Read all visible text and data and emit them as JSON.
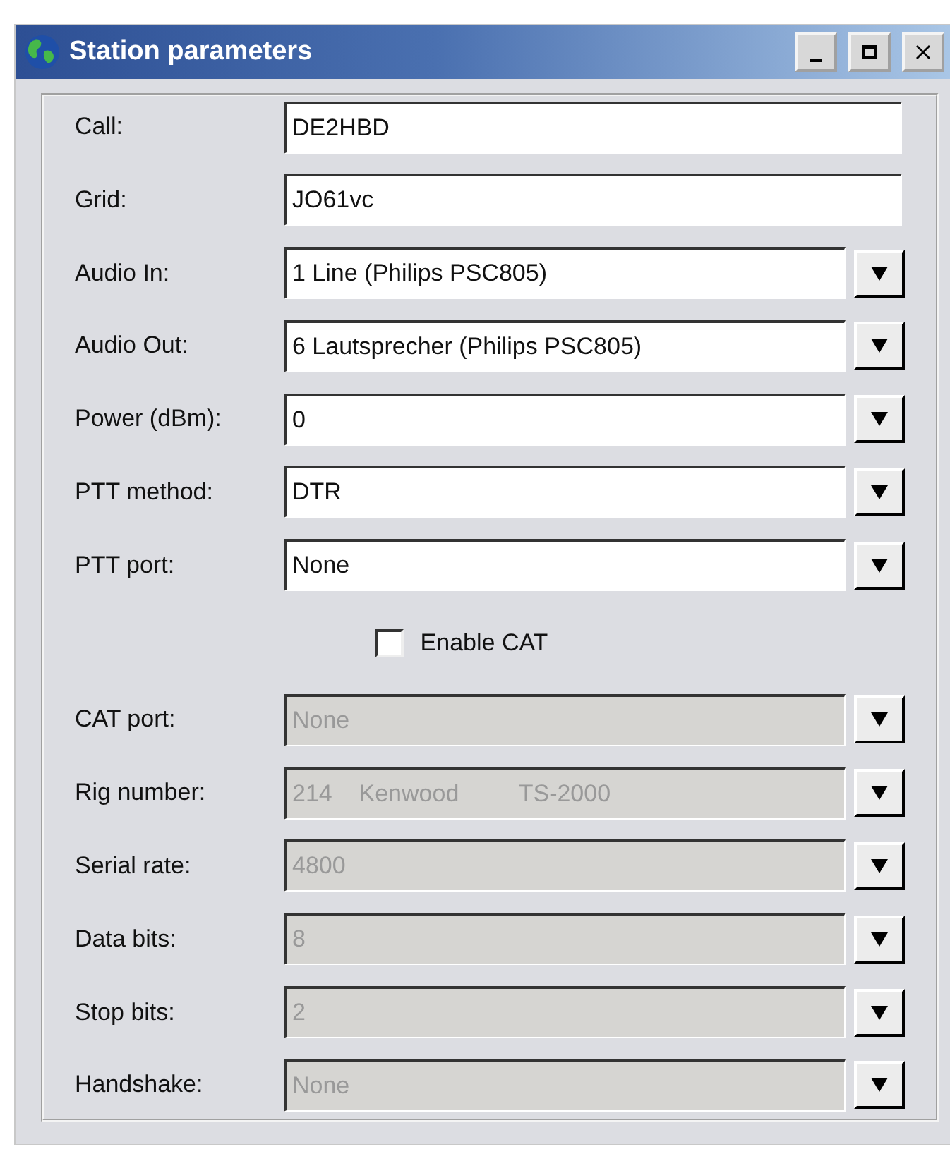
{
  "window": {
    "title": "Station parameters"
  },
  "title_buttons": [
    {
      "kind": "minimize"
    },
    {
      "kind": "maximize"
    },
    {
      "kind": "close"
    }
  ],
  "fields": [
    {
      "label": "Call:",
      "value": "DE2HBD",
      "kind": "text",
      "disabled": false
    },
    {
      "label": "Grid:",
      "value": "JO61vc",
      "kind": "text",
      "disabled": false
    },
    {
      "label": "Audio In:",
      "value": "1 Line (Philips PSC805)",
      "kind": "dropdown",
      "disabled": false
    },
    {
      "label": "Audio Out:",
      "value": "6 Lautsprecher (Philips PSC805)",
      "kind": "dropdown",
      "disabled": false
    },
    {
      "label": "Power (dBm):",
      "value": "0",
      "kind": "dropdown",
      "disabled": false
    },
    {
      "label": "PTT method:",
      "value": "DTR",
      "kind": "dropdown",
      "disabled": false
    },
    {
      "label": "PTT port:",
      "value": "None",
      "kind": "dropdown",
      "disabled": false
    }
  ],
  "enable_cat": {
    "label": "Enable CAT",
    "checked": false
  },
  "cat_fields": [
    {
      "label": "CAT port:",
      "value": "None",
      "kind": "dropdown",
      "disabled": true
    },
    {
      "label": "Rig number:",
      "value": "214    Kenwood         TS-2000",
      "kind": "dropdown",
      "disabled": true
    },
    {
      "label": "Serial rate:",
      "value": "4800",
      "kind": "dropdown",
      "disabled": true
    },
    {
      "label": "Data bits:",
      "value": "8",
      "kind": "dropdown",
      "disabled": true
    },
    {
      "label": "Stop bits:",
      "value": "2",
      "kind": "dropdown",
      "disabled": true
    },
    {
      "label": "Handshake:",
      "value": "None",
      "kind": "dropdown",
      "disabled": true
    }
  ]
}
